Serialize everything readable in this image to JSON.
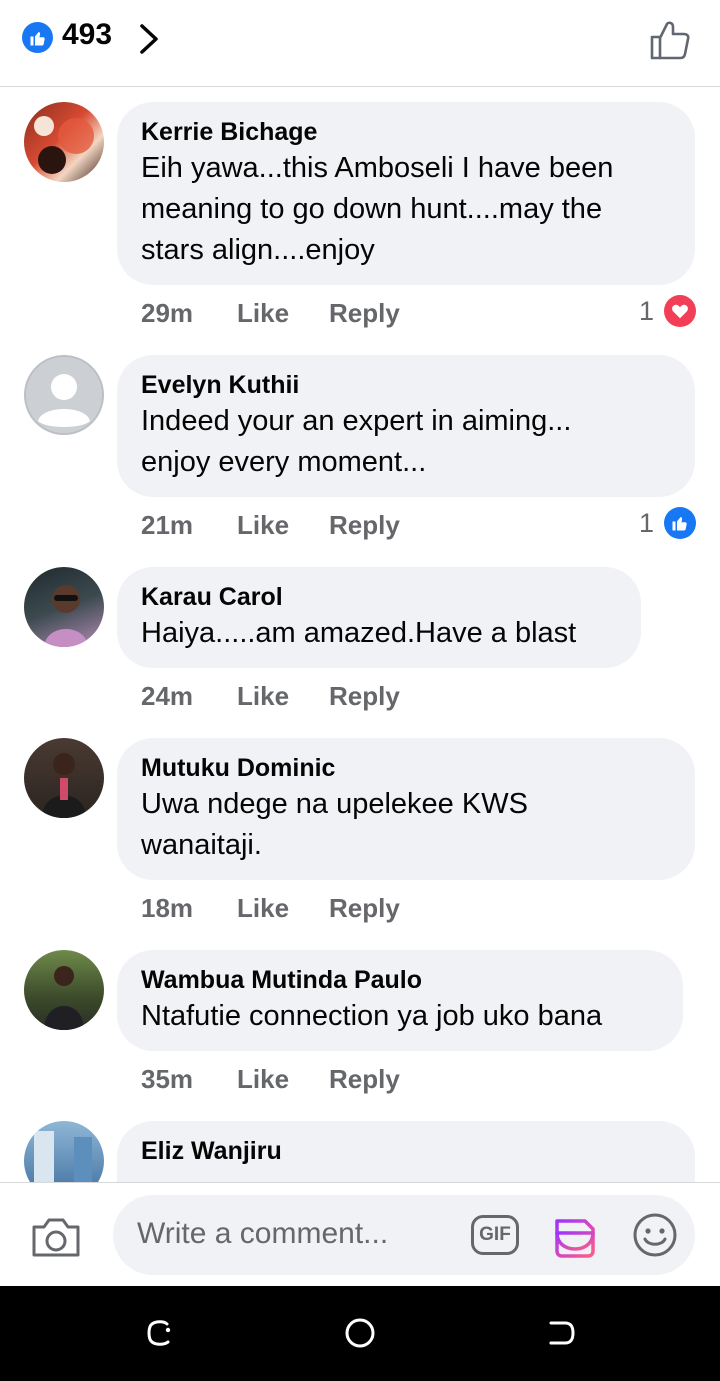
{
  "header": {
    "like_count": "493"
  },
  "comments": [
    {
      "author": "Kerrie Bichage",
      "text": "Eih yawa...this Amboseli I have been meaning to go down hunt....may the stars align....enjoy",
      "time": "29m",
      "like_label": "Like",
      "reply_label": "Reply",
      "reaction_count": "1",
      "reaction_type": "love-icon"
    },
    {
      "author": "Evelyn Kuthii",
      "text": "Indeed your an expert in aiming... enjoy every moment...",
      "time": "21m",
      "like_label": "Like",
      "reply_label": "Reply",
      "reaction_count": "1",
      "reaction_type": "like-icon"
    },
    {
      "author": "Karau Carol",
      "text": "Haiya.....am amazed.Have a blast",
      "time": "24m",
      "like_label": "Like",
      "reply_label": "Reply"
    },
    {
      "author": "Mutuku Dominic",
      "text": "Uwa ndege na upelekee KWS wanaitaji.",
      "time": "18m",
      "like_label": "Like",
      "reply_label": "Reply"
    },
    {
      "author": "Wambua Mutinda Paulo",
      "text": "Ntafutie connection ya job uko bana",
      "time": "35m",
      "like_label": "Like",
      "reply_label": "Reply"
    },
    {
      "author": "Eliz Wanjiru"
    }
  ],
  "composer": {
    "placeholder": "Write a comment...",
    "gif_label": "GIF"
  },
  "colors": {
    "facebook_blue": "#1877f2",
    "love_red": "#f33e58",
    "bubble_bg": "#f0f2f5",
    "secondary_text": "#65676b"
  }
}
